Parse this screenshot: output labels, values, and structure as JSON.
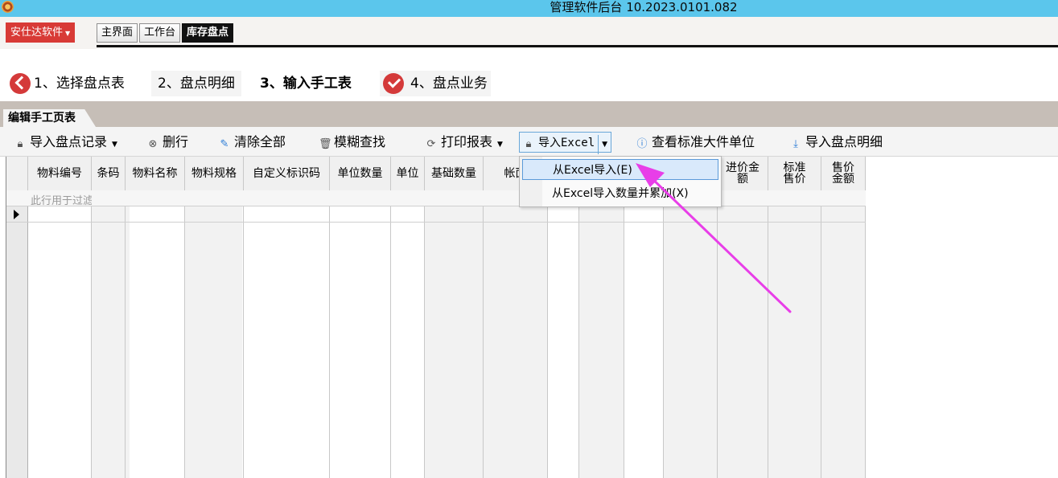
{
  "window": {
    "title": "管理软件后台  10.2023.0101.082",
    "icon": "app-icon"
  },
  "menubar": {
    "brand": "安仕达软件",
    "tabs": [
      {
        "label": "主界面",
        "active": false
      },
      {
        "label": "工作台",
        "active": false
      },
      {
        "label": "库存盘点",
        "active": true
      }
    ]
  },
  "wizard": {
    "steps": [
      {
        "label": "1、选择盘点表",
        "icon": "back-arrow-icon"
      },
      {
        "label": "2、盘点明细"
      },
      {
        "label": "3、输入手工表",
        "active": true
      },
      {
        "label": "4、盘点业务",
        "icon": "check-circle-icon"
      }
    ]
  },
  "panel": {
    "tab_label": "编辑手工页表"
  },
  "toolbar": {
    "import_records": "导入盘点记录",
    "delete_row": "删行",
    "clear_all": "清除全部",
    "fuzzy_find": "模糊查找",
    "print_report": "打印报表",
    "import_excel": "导入Excel",
    "view_units": "查看标准大件单位",
    "import_details": "导入盘点明细"
  },
  "grid": {
    "columns": [
      "物料编号",
      "条码",
      "物料名称",
      "物料规格",
      "自定义标识码",
      "单位数量",
      "单位",
      "基础数量",
      "帐面",
      "",
      "",
      "",
      "",
      "进价金额",
      "标准售价",
      "售价金额"
    ],
    "filter_placeholder": "此行用于过滤"
  },
  "excel_menu": {
    "items": [
      {
        "label": "从Excel导入(E)",
        "highlighted": true
      },
      {
        "label": "从Excel导入数量并累加(X)",
        "highlighted": false
      }
    ]
  },
  "colors": {
    "titlebar": "#5bc6ec",
    "brand": "#d83a36",
    "annotation_arrow": "#e83ee8"
  }
}
